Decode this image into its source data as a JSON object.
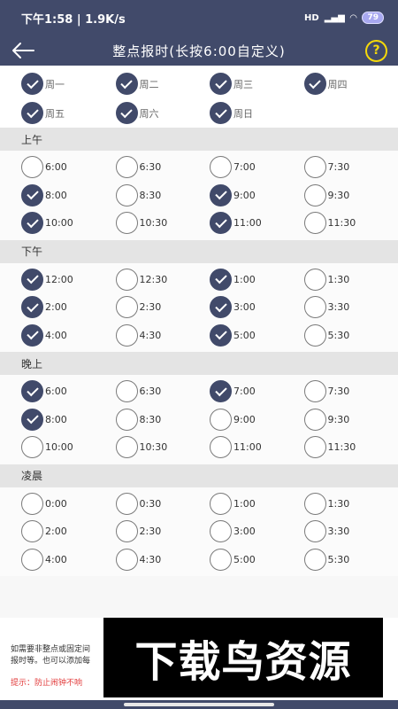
{
  "status_bar": {
    "time": "下午1:58 | 1.9K/s",
    "network": "HD",
    "battery": "79"
  },
  "header": {
    "title": "整点报时(长按6:00自定义)",
    "help_label": "?"
  },
  "weekdays": [
    {
      "label": "周一",
      "checked": true
    },
    {
      "label": "周二",
      "checked": true
    },
    {
      "label": "周三",
      "checked": true
    },
    {
      "label": "周四",
      "checked": true
    },
    {
      "label": "周五",
      "checked": true
    },
    {
      "label": "周六",
      "checked": true
    },
    {
      "label": "周日",
      "checked": true
    }
  ],
  "sections": [
    {
      "title": "上午",
      "slots": [
        {
          "time": "6:00",
          "checked": false
        },
        {
          "time": "6:30",
          "checked": false
        },
        {
          "time": "7:00",
          "checked": false
        },
        {
          "time": "7:30",
          "checked": false
        },
        {
          "time": "8:00",
          "checked": true
        },
        {
          "time": "8:30",
          "checked": false
        },
        {
          "time": "9:00",
          "checked": true
        },
        {
          "time": "9:30",
          "checked": false
        },
        {
          "time": "10:00",
          "checked": true
        },
        {
          "time": "10:30",
          "checked": false
        },
        {
          "time": "11:00",
          "checked": true
        },
        {
          "time": "11:30",
          "checked": false
        }
      ]
    },
    {
      "title": "下午",
      "slots": [
        {
          "time": "12:00",
          "checked": true
        },
        {
          "time": "12:30",
          "checked": false
        },
        {
          "time": "1:00",
          "checked": true
        },
        {
          "time": "1:30",
          "checked": false
        },
        {
          "time": "2:00",
          "checked": true
        },
        {
          "time": "2:30",
          "checked": false
        },
        {
          "time": "3:00",
          "checked": true
        },
        {
          "time": "3:30",
          "checked": false
        },
        {
          "time": "4:00",
          "checked": true
        },
        {
          "time": "4:30",
          "checked": false
        },
        {
          "time": "5:00",
          "checked": true
        },
        {
          "time": "5:30",
          "checked": false
        }
      ]
    },
    {
      "title": "晚上",
      "slots": [
        {
          "time": "6:00",
          "checked": true
        },
        {
          "time": "6:30",
          "checked": false
        },
        {
          "time": "7:00",
          "checked": true
        },
        {
          "time": "7:30",
          "checked": false
        },
        {
          "time": "8:00",
          "checked": true
        },
        {
          "time": "8:30",
          "checked": false
        },
        {
          "time": "9:00",
          "checked": false
        },
        {
          "time": "9:30",
          "checked": false
        },
        {
          "time": "10:00",
          "checked": false
        },
        {
          "time": "10:30",
          "checked": false
        },
        {
          "time": "11:00",
          "checked": false
        },
        {
          "time": "11:30",
          "checked": false
        }
      ]
    },
    {
      "title": "凌晨",
      "slots": [
        {
          "time": "0:00",
          "checked": false
        },
        {
          "time": "0:30",
          "checked": false
        },
        {
          "time": "1:00",
          "checked": false
        },
        {
          "time": "1:30",
          "checked": false
        },
        {
          "time": "2:00",
          "checked": false
        },
        {
          "time": "2:30",
          "checked": false
        },
        {
          "time": "3:00",
          "checked": false
        },
        {
          "time": "3:30",
          "checked": false
        },
        {
          "time": "4:00",
          "checked": false
        },
        {
          "time": "4:30",
          "checked": false
        },
        {
          "time": "5:00",
          "checked": false
        },
        {
          "time": "5:30",
          "checked": false
        }
      ]
    }
  ],
  "footer": {
    "note_line1": "如需要非整点或固定间",
    "note_line2": "报时等。也可以添加每",
    "tip": "提示：防止闹钟不响"
  },
  "watermark": "下载鸟资源",
  "colors": {
    "primary": "#414a6a",
    "help_accent": "#f5d90a",
    "tip_text": "#e23b3b"
  }
}
